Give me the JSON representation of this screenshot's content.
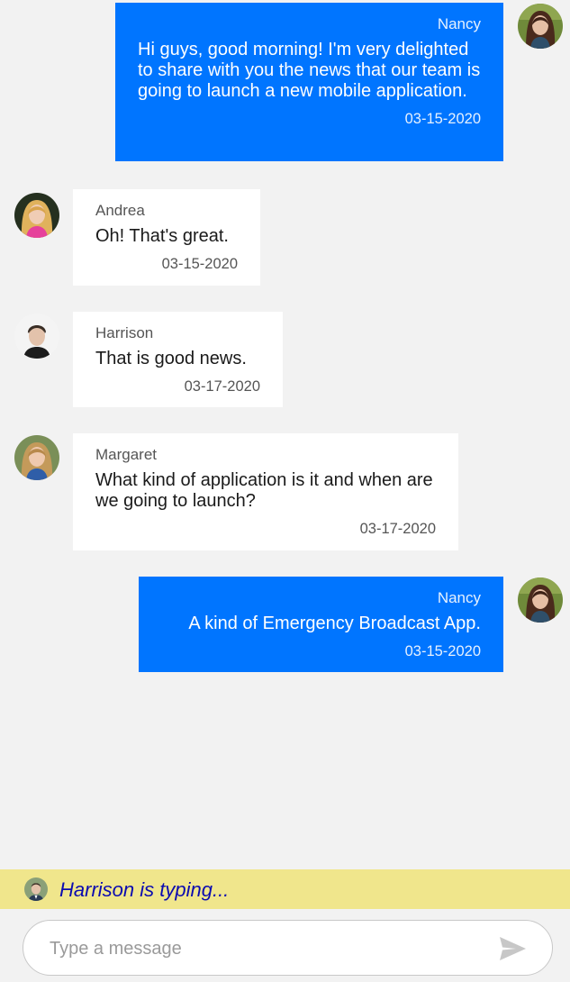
{
  "messages": [
    {
      "direction": "outgoing",
      "author": "Nancy",
      "avatar_icon": "nancy-avatar",
      "text": "Hi guys, good morning! I'm very delighted to share with you the news that our team is going to launch a new mobile application.",
      "time": "03-15-2020"
    },
    {
      "direction": "incoming",
      "author": "Andrea",
      "avatar_icon": "andrea-avatar",
      "text": "Oh! That's great.",
      "time": "03-15-2020"
    },
    {
      "direction": "incoming",
      "author": "Harrison",
      "avatar_icon": "harrison-avatar",
      "text": "That is good news.",
      "time": "03-17-2020"
    },
    {
      "direction": "incoming",
      "author": "Margaret",
      "avatar_icon": "margaret-avatar",
      "text": "What kind of application is it and when are we going to launch?",
      "time": "03-17-2020"
    },
    {
      "direction": "outgoing",
      "author": "Nancy",
      "avatar_icon": "nancy-avatar",
      "text": "A kind of Emergency Broadcast App.",
      "time": "03-15-2020"
    }
  ],
  "typing_indicator": {
    "text": "Harrison is typing...",
    "avatar_icon": "harrison-avatar"
  },
  "composer": {
    "placeholder": "Type a message",
    "value": "",
    "send_icon": "send-icon"
  },
  "colors": {
    "outgoing_bubble": "#0075ff",
    "incoming_bubble": "#ffffff",
    "background": "#f2f2f2",
    "typing_bar": "#f0e68c",
    "typing_text": "#0b0bb0"
  }
}
